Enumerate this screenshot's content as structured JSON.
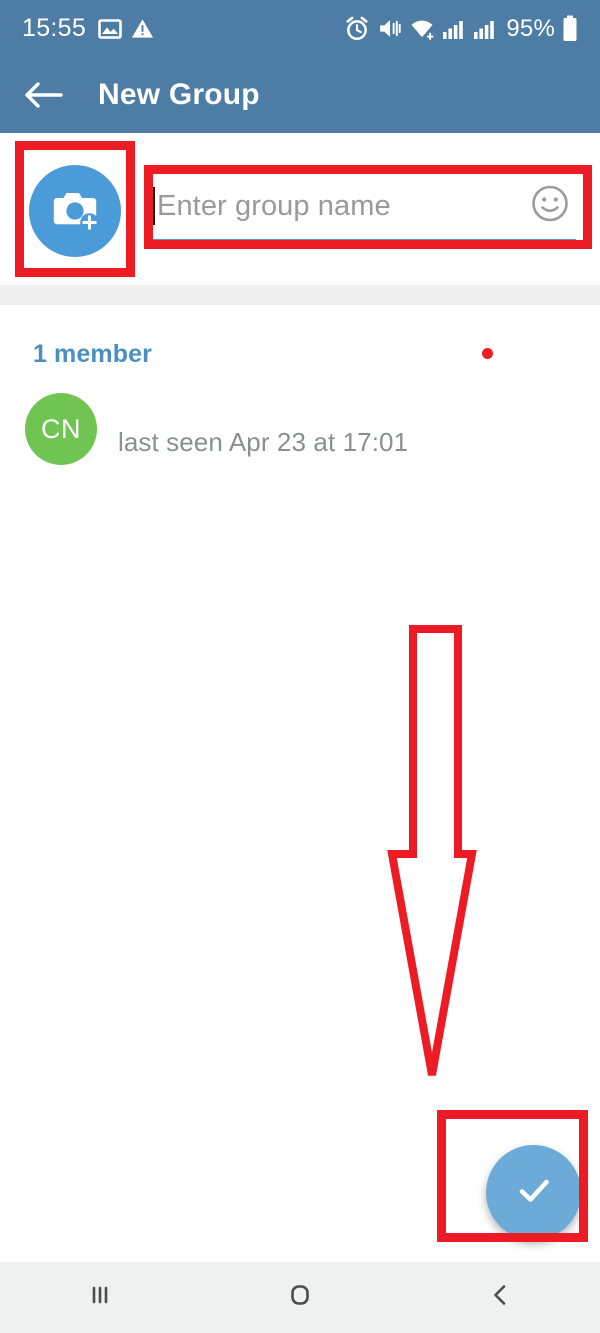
{
  "status_bar": {
    "clock": "15:55",
    "battery_text": "95%",
    "icons_left": [
      "image-icon",
      "warning-icon"
    ],
    "icons_right": [
      "alarm-icon",
      "mute-vibrate-icon",
      "wifi-icon",
      "signal-sim1-icon",
      "signal-sim2-icon",
      "battery-icon"
    ],
    "background_color": "#4d7da4"
  },
  "app_bar": {
    "title": "New Group",
    "back_icon": "back-arrow-icon",
    "background_color": "#4d7da4"
  },
  "group_setup": {
    "avatar_icon": "camera-add-icon",
    "avatar_color": "#4a9bd8",
    "name_input": {
      "value": "",
      "placeholder": "Enter group name",
      "underline_color": "#4a9bd8",
      "emoji_icon": "smiley-face-icon"
    }
  },
  "members": {
    "count_label": "1 member",
    "count_label_color": "#4a8fc0",
    "list": [
      {
        "initials": "CN",
        "avatar_color": "#6fc452",
        "status": "last seen Apr 23 at 17:01"
      }
    ]
  },
  "fab": {
    "icon": "check-icon",
    "color": "#6cabd8"
  },
  "nav_bar": {
    "items": [
      {
        "name": "recents-button",
        "icon": "recents-icon"
      },
      {
        "name": "home-button",
        "icon": "home-icon"
      },
      {
        "name": "back-button",
        "icon": "back-chevron-icon"
      }
    ],
    "background_color": "#eff0f0"
  },
  "annotations": {
    "color": "#ed1c24",
    "boxes": [
      "group-avatar-highlight",
      "group-name-input-highlight",
      "confirm-fab-highlight"
    ],
    "arrow": "down-arrow-to-confirm",
    "dot": "member-row-marker"
  }
}
